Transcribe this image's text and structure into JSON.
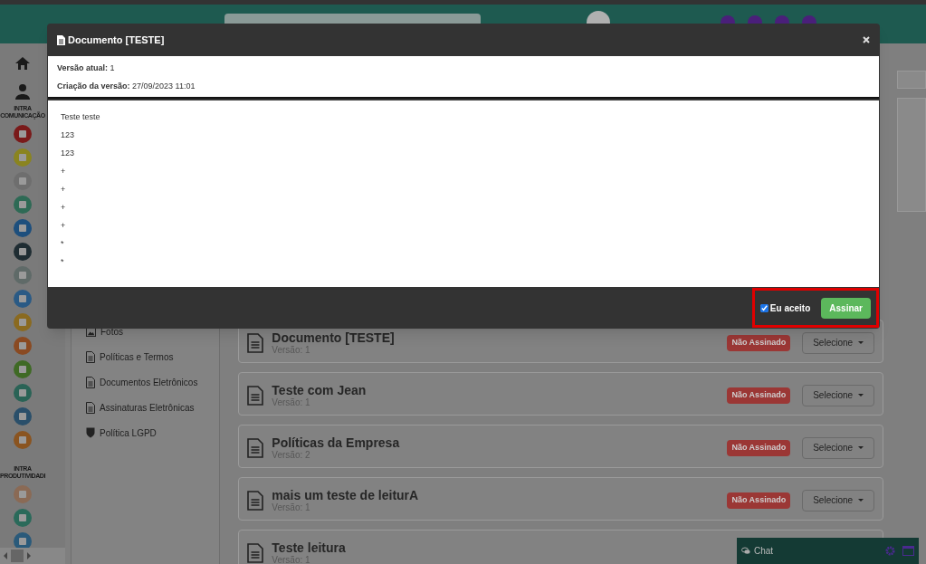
{
  "sidebar": {
    "sections": [
      {
        "label": "INTRA COMUNICAÇÃO",
        "apps": [
          {
            "color": "#7a1a1a"
          },
          {
            "color": "#8a8420"
          },
          {
            "color": "#6e6e6e"
          },
          {
            "color": "#2e6a55"
          },
          {
            "color": "#1d4f7d"
          },
          {
            "color": "#1f2d33"
          },
          {
            "color": "#5f6a68"
          },
          {
            "color": "#2a5a85"
          },
          {
            "color": "#8a6a20"
          },
          {
            "color": "#8a4a22"
          },
          {
            "color": "#3f6a25"
          },
          {
            "color": "#2a6356"
          },
          {
            "color": "#2a4f6a"
          },
          {
            "color": "#8a5420"
          }
        ]
      },
      {
        "label": "INTRA PRODUTIVIDADI",
        "apps": [
          {
            "color": "#8a6a55"
          },
          {
            "color": "#2a6a5a"
          },
          {
            "color": "#2a5a7a"
          }
        ]
      }
    ]
  },
  "menu": {
    "items": [
      {
        "label": "Fotos",
        "kind": "photo"
      },
      {
        "label": "Políticas e Termos",
        "kind": "document"
      },
      {
        "label": "Documentos Eletrônicos",
        "kind": "document"
      },
      {
        "label": "Assinaturas Eletrônicas",
        "kind": "document"
      },
      {
        "label": "Política LGPD",
        "kind": "shield"
      }
    ]
  },
  "documents": [
    {
      "title": "Documento [TESTE]",
      "version": "Versão: 1",
      "status": "Não Assinado",
      "action": "Selecione"
    },
    {
      "title": "Teste com Jean",
      "version": "Versão: 1",
      "status": "Não Assinado",
      "action": "Selecione"
    },
    {
      "title": "Políticas da Empresa",
      "version": "Versão: 2",
      "status": "Não Assinado",
      "action": "Selecione"
    },
    {
      "title": "mais um teste de leiturA",
      "version": "Versão: 1",
      "status": "Não Assinado",
      "action": "Selecione"
    },
    {
      "title": "Teste leitura",
      "version": "Versão: 1"
    }
  ],
  "modal": {
    "title": "Documento [TESTE]",
    "info": [
      {
        "label": "Versão atual:",
        "value": "1"
      },
      {
        "label": "Criação da versão:",
        "value": "27/09/2023 11:01"
      }
    ],
    "body_lines": [
      "Teste teste",
      "123",
      "123",
      "+",
      "+",
      "+",
      "+",
      "*",
      "*"
    ],
    "accept": {
      "label": "Eu aceito",
      "checked": true
    },
    "sign_button": "Assinar"
  },
  "chat": {
    "label": "Chat"
  }
}
